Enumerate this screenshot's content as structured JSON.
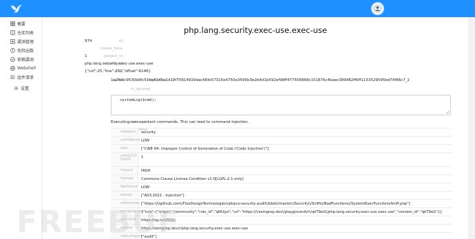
{
  "colors": {
    "topbar": "#1e90ff",
    "sidebar_bg": "#ffffff",
    "page_bg": "#f0f2f5"
  },
  "icons": {
    "logo": "bird-logo-icon",
    "avatar": "user-avatar-icon"
  },
  "sidebar": {
    "items": [
      {
        "label": "概要",
        "icon": "dashboard-icon"
      },
      {
        "label": "仓库列表",
        "icon": "repo-icon"
      },
      {
        "label": "漏洞管理",
        "icon": "bug-icon"
      },
      {
        "label": "危险函数",
        "icon": "warning-icon"
      },
      {
        "label": "依赖漏洞",
        "icon": "package-icon"
      },
      {
        "label": "Webshell",
        "icon": "shell-icon"
      },
      {
        "label": "组件清单",
        "icon": "list-icon"
      },
      {
        "label": "设置",
        "icon": "gear-icon"
      }
    ]
  },
  "detail": {
    "title": "php.lang.security.exec-use.exec-use",
    "fields": [
      {
        "label": "id",
        "value": "974"
      },
      {
        "label": "create_time",
        "value": ""
      },
      {
        "label": "project_id",
        "value": "1"
      },
      {
        "label": "check_id",
        "value": "php.lang.security.exec-use.exec-use"
      },
      {
        "label": "end",
        "value": "{\"col\":25,\"line\":232,\"offset\":6146}"
      },
      {
        "label": "extra",
        "value": ""
      },
      {
        "label": "fingerprint",
        "value": "1a2fb6c9530b9fc519e8145a1d18f75614919dac66fe57315e4750e3595b3b2b4d1b592ef98ff477556868c151876c4baec389482ff6ff1133529595bd74f86c7_2"
      },
      {
        "label": "is_ignored",
        "value": ""
      },
      {
        "label": "lines",
        "value": ""
      },
      {
        "label": "message",
        "value": "Executing non-constant commands. This can lead to command injection."
      },
      {
        "label": "metadata",
        "value": ""
      }
    ],
    "lines_code": "systemLog($cmd);",
    "metadata": [
      {
        "key": "category",
        "value": "security"
      },
      {
        "key": "confidence",
        "value": "LOW"
      },
      {
        "key": "cwe",
        "value": "[\"CWE-94: Improper Control of Generation of Code ('Code Injection')\"]"
      },
      {
        "key": "cwe2022-top25",
        "value": "1"
      },
      {
        "key": "impact",
        "value": "HIGH"
      },
      {
        "key": "license",
        "value": "Commons Clause License Condition v1.0[LGPL-2.1-only]"
      },
      {
        "key": "likelihood",
        "value": "LOW"
      },
      {
        "key": "owasp",
        "value": "[\"A03:2021 - Injection\"]"
      },
      {
        "key": "references",
        "value": "[\"https:\\/\\/github.com\\/FloeDesignTechnologies\\/phpcs-security-audit\\/blob\\/master\\/Security\\/Sniffs\\/BadFunctions\\/SystemExecFunctionsSniff.php\"]"
      },
      {
        "key": "semgrep.dev",
        "value": "{\"rule\":{\"origin\":\"community\",\"rule_id\":\"qNUjye\",\"url\":\"https:\\/\\/semgrep.dev\\/playground\\/r\\/qkT9eG\\/php.lang.security.exec-use.exec-use\",\"version_id\":\"qkT9eG\"}}"
      },
      {
        "key": "shortlink",
        "value": "https://sg.run/5Q1j"
      },
      {
        "key": "source",
        "value": "https://semgrep.dev/r/php.lang.security.exec-use.exec-use"
      },
      {
        "key": "subcategory",
        "value": "[\"audit\"]"
      }
    ]
  },
  "watermark": "FREEBUF"
}
